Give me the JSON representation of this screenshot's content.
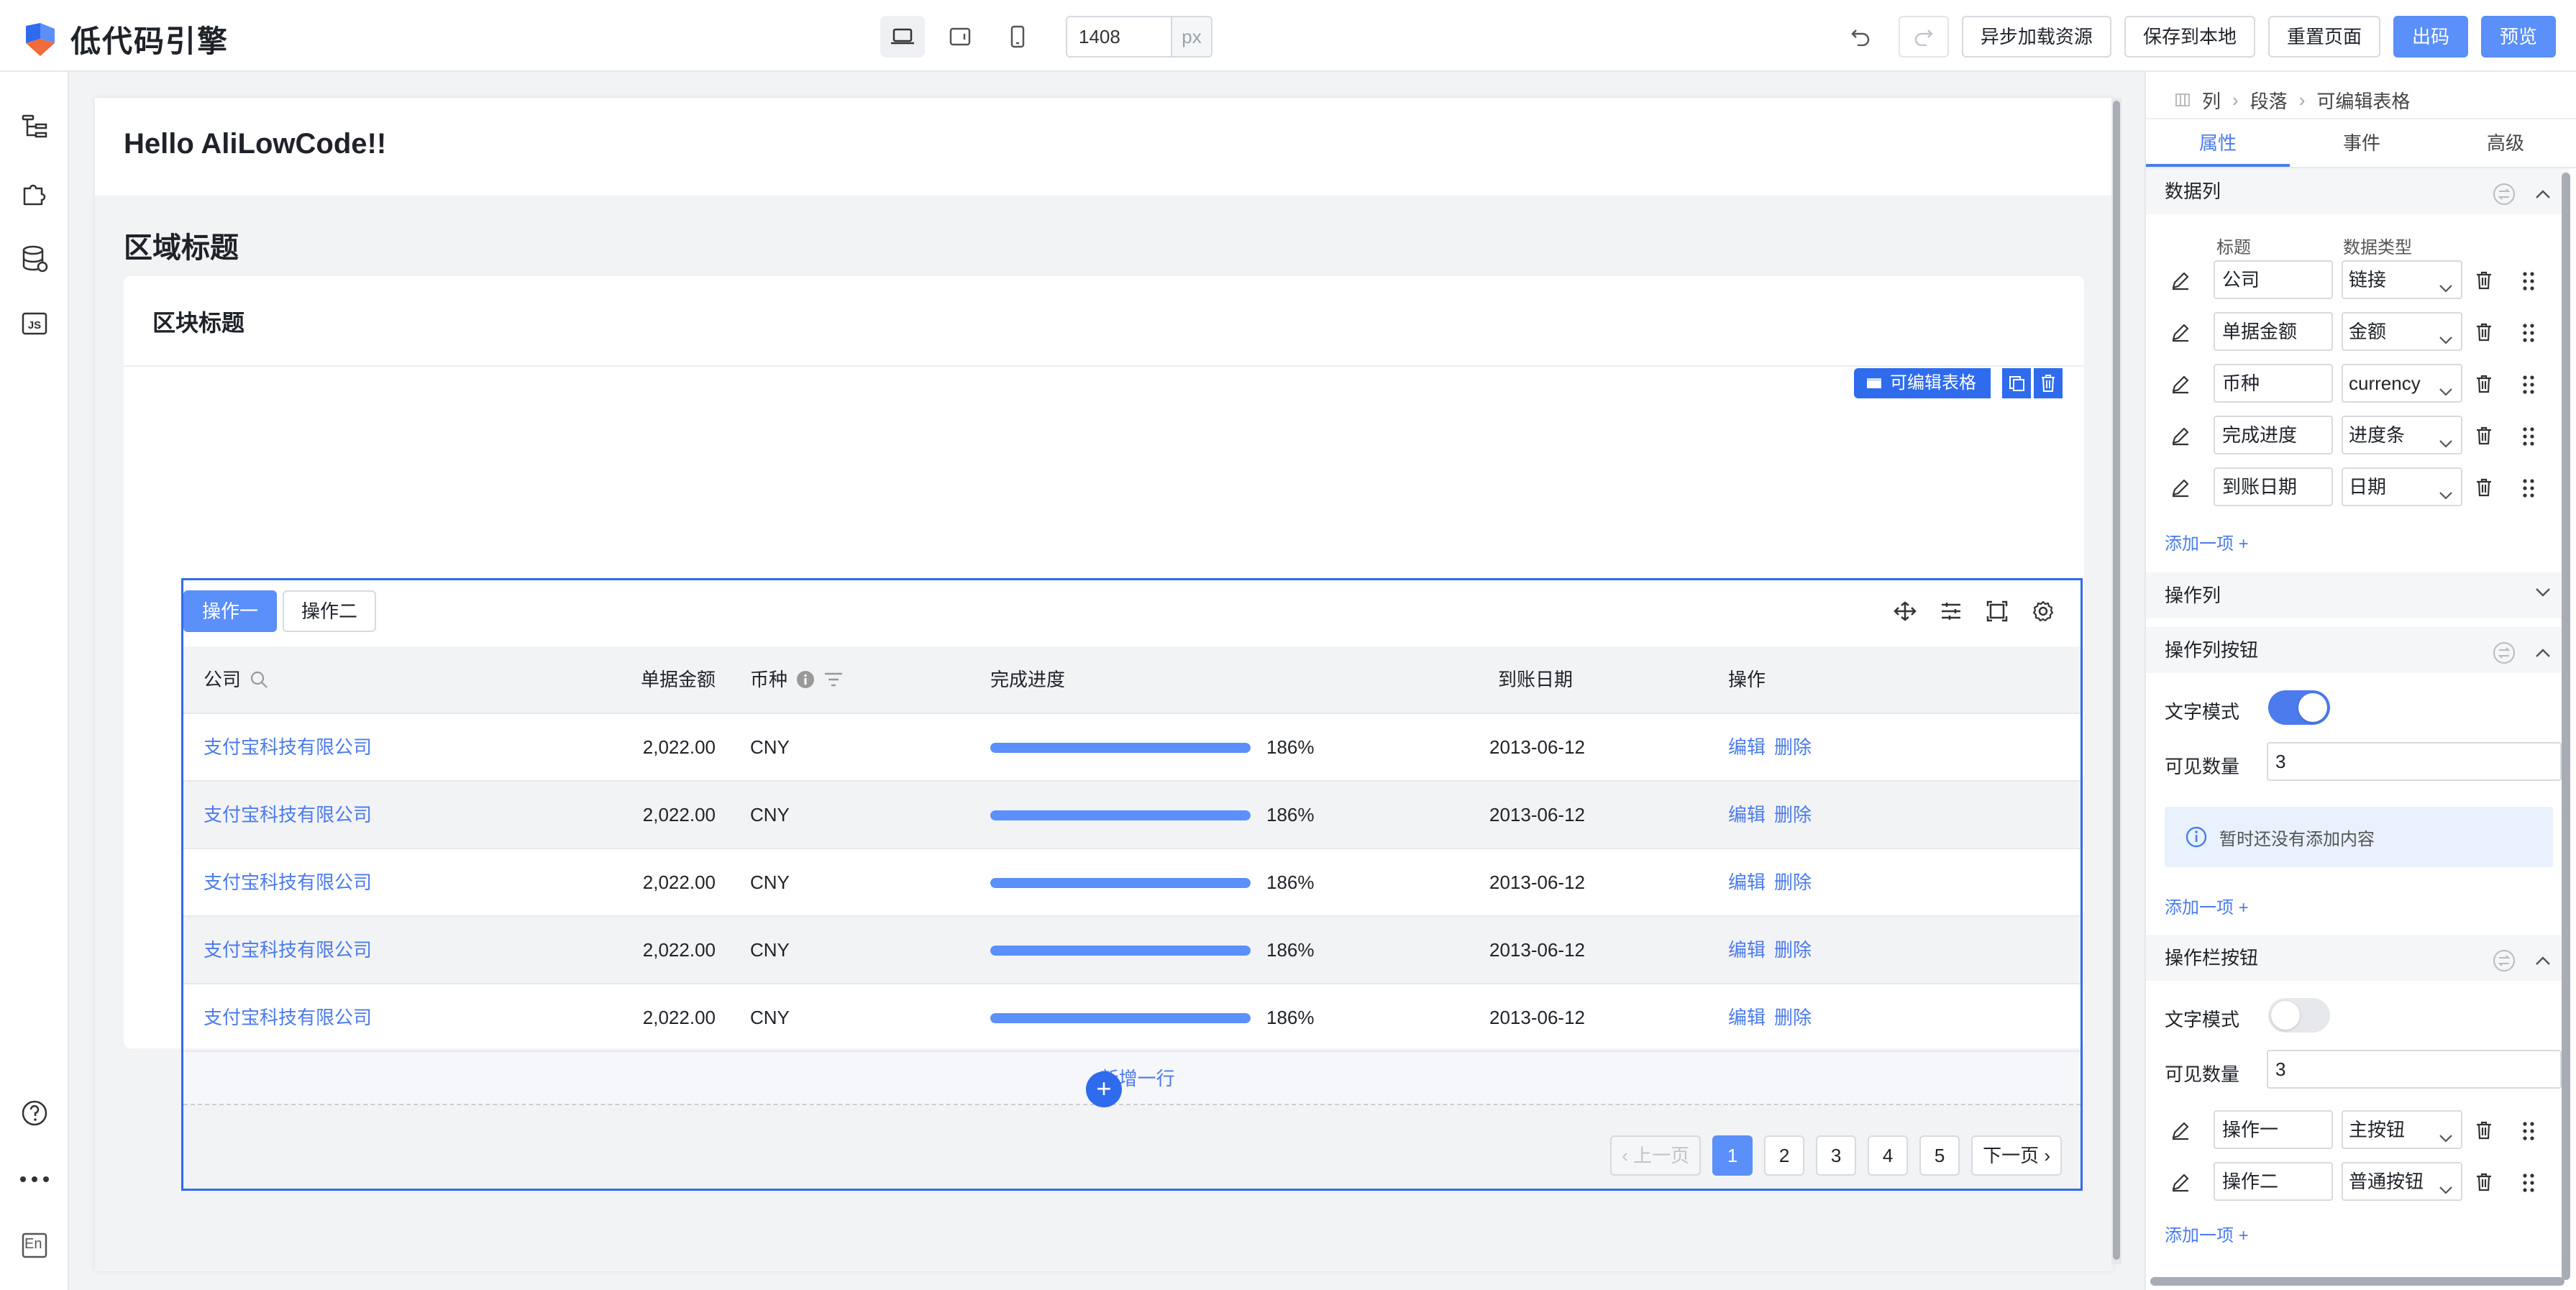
{
  "app": {
    "title": "低代码引擎"
  },
  "toolbar": {
    "width_value": "1408",
    "width_unit": "px",
    "async_load": "异步加载资源",
    "save_local": "保存到本地",
    "reset_page": "重置页面",
    "export_code": "出码",
    "preview": "预览",
    "accent": "#5b8ff9"
  },
  "leftrail": {
    "lang": "En"
  },
  "canvas": {
    "hello": "Hello AliLowCode!!",
    "area_title": "区域标题",
    "block_title": "区块标题",
    "selection_label": "可编辑表格",
    "table": {
      "action_primary": "操作一",
      "action_secondary": "操作二",
      "headers": [
        "公司",
        "单据金额",
        "币种",
        "完成进度",
        "到账日期",
        "操作"
      ],
      "rows": [
        {
          "company": "支付宝科技有限公司",
          "amount": "2,022.00",
          "currency": "CNY",
          "progress": 186,
          "progress_text": "186%",
          "date": "2013-06-12",
          "edit": "编辑",
          "delete": "删除"
        },
        {
          "company": "支付宝科技有限公司",
          "amount": "2,022.00",
          "currency": "CNY",
          "progress": 186,
          "progress_text": "186%",
          "date": "2013-06-12",
          "edit": "编辑",
          "delete": "删除"
        },
        {
          "company": "支付宝科技有限公司",
          "amount": "2,022.00",
          "currency": "CNY",
          "progress": 186,
          "progress_text": "186%",
          "date": "2013-06-12",
          "edit": "编辑",
          "delete": "删除"
        },
        {
          "company": "支付宝科技有限公司",
          "amount": "2,022.00",
          "currency": "CNY",
          "progress": 186,
          "progress_text": "186%",
          "date": "2013-06-12",
          "edit": "编辑",
          "delete": "删除"
        },
        {
          "company": "支付宝科技有限公司",
          "amount": "2,022.00",
          "currency": "CNY",
          "progress": 186,
          "progress_text": "186%",
          "date": "2013-06-12",
          "edit": "编辑",
          "delete": "删除"
        }
      ],
      "add_row": "+新增一行",
      "pager": {
        "prev": "上一页",
        "next": "下一页",
        "pages": [
          "1",
          "2",
          "3",
          "4",
          "5"
        ],
        "current": "1"
      }
    }
  },
  "panel": {
    "breadcrumb": [
      "列",
      "段落",
      "可编辑表格"
    ],
    "tabs": [
      "属性",
      "事件",
      "高级"
    ],
    "active_tab": "属性",
    "data_columns": {
      "title": "数据列",
      "col_title": "标题",
      "col_type": "数据类型",
      "items": [
        {
          "title": "公司",
          "type": "链接"
        },
        {
          "title": "单据金额",
          "type": "金额"
        },
        {
          "title": "币种",
          "type": "currency"
        },
        {
          "title": "完成进度",
          "type": "进度条"
        },
        {
          "title": "到账日期",
          "type": "日期"
        }
      ],
      "add": "添加一项 +"
    },
    "op_column": {
      "title": "操作列"
    },
    "op_column_buttons": {
      "title": "操作列按钮",
      "text_mode_label": "文字模式",
      "text_mode": true,
      "visible_count_label": "可见数量",
      "visible_count": "3",
      "empty_hint": "暂时还没有添加内容",
      "add": "添加一项 +"
    },
    "op_bar_buttons": {
      "title": "操作栏按钮",
      "text_mode_label": "文字模式",
      "text_mode": false,
      "visible_count_label": "可见数量",
      "visible_count": "3",
      "items": [
        {
          "title": "操作一",
          "type": "主按钮"
        },
        {
          "title": "操作二",
          "type": "普通按钮"
        }
      ],
      "add": "添加一项 +"
    }
  }
}
